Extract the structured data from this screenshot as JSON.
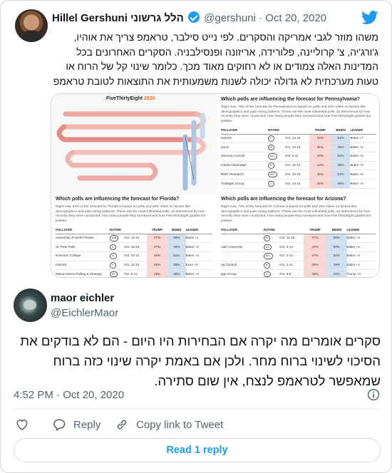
{
  "quoted_tweet": {
    "author_name": "Hillel Gershuni הלל גרשוני",
    "handle": "@gershuni",
    "separator": "·",
    "date": "Oct 20, 2020",
    "text_lines": [
      "משהו מוזר לגבי אמריקה והסקרים. לפי נייט סילבר, טראמפ צריך את אוהיו,",
      "ג'ורג'יה, צ' קרוליינה, פלורידה, אריזונה ופנסילבניה. הסקרים האחרונים בכל",
      "המדינות האלה צמודים או לא רחוקים מאוד מכך. כלומר שינוי קל של הרוח או",
      "טעות מערכתית לא גדולה יכולה לשנות משמעותית את התוצאות לטובת טראמפ"
    ],
    "image": {
      "brand": "FiveThirtyEight",
      "brand_year": "2020",
      "panels": [
        {
          "title": "Which polls are influencing the forecast for Pennsylvania?",
          "description": "Right now, 78% of the forecast for Pennsylvania is based on polls and 22% relies on factors like demographics and past voting patterns. These are the most influential polls, as determined by how recently they were conducted, how many people they surveyed and how FiveThirtyEight grades the pollster.",
          "headers": [
            "POLLSTER",
            "RATING",
            "",
            "TRUMP",
            "BIDEN",
            "LEADER"
          ],
          "rows": [
            {
              "pollster": "HarrisX",
              "rating": "C",
              "date": "Oct. 12-16",
              "trump": "44%",
              "biden": "51%",
              "leader": "Biden +7",
              "lead_party": "b"
            },
            {
              "pollster": "Ipsos",
              "rating": "B",
              "date": "Oct. 13-19",
              "trump": "45%",
              "biden": "49%",
              "leader": "Biden +4",
              "lead_party": "b"
            },
            {
              "pollster": "Morning Consult",
              "rating": "B/C",
              "date": "Oct. 2-11",
              "trump": "44%",
              "biden": "52%",
              "leader": "Biden +8",
              "lead_party": "b"
            },
            {
              "pollster": "InsiderAdvantage",
              "rating": "B",
              "date": "Oct. 12-13",
              "trump": "43%",
              "biden": "46%",
              "leader": "Biden +3",
              "lead_party": "b"
            },
            {
              "pollster": "RMG Research",
              "rating": "B/C",
              "date": "Oct. 13-15",
              "trump": "45%",
              "biden": "51%",
              "leader": "Biden +6",
              "lead_party": "b"
            },
            {
              "pollster": "Trafalgar Group",
              "rating": "C",
              "date": "Oct. 14-16",
              "trump": "45%",
              "biden": "48%",
              "leader": "Biden +3",
              "lead_party": "b"
            }
          ]
        },
        {
          "title": "Which polls are influencing the forecast for Florida?",
          "description": "Right now, 84% of the forecast for Florida is based on polls and 16% relies on factors like demographics and past voting patterns. These are the most influential polls, as determined by how recently they were conducted, how many people they surveyed and how FiveThirtyEight grades the pollster.",
          "headers": [
            "POLLSTER",
            "RATING",
            "",
            "TRUMP",
            "BIDEN",
            "LEADER"
          ],
          "rows": [
            {
              "pollster": "University of North Florida",
              "rating": "A/B",
              "date": "Oct. 12-16",
              "trump": "47%",
              "biden": "48%",
              "leader": "Biden +1",
              "lead_party": "b"
            },
            {
              "pollster": "St. Pete Polls",
              "rating": "C",
              "date": "Oct. 15-19",
              "trump": "47%",
              "biden": "49%",
              "leader": "Biden +2",
              "lead_party": "b"
            },
            {
              "pollster": "Emerson College",
              "rating": "A-",
              "date": "Oct. 10-12",
              "trump": "48%",
              "biden": "51%",
              "leader": "Biden +3",
              "lead_party": "b"
            },
            {
              "pollster": "HarrisX",
              "rating": "C",
              "date": "Oct. 12-15",
              "trump": "48%",
              "biden": "48%",
              "leader": "Even +0",
              "lead_party": "b"
            },
            {
              "pollster": "Mason-Dixon Polling & Strategy",
              "rating": "B+",
              "date": "Oct. 8-12",
              "trump": "45%",
              "biden": "48%",
              "leader": "Biden +3",
              "lead_party": "b"
            },
            {
              "pollster": "Trafalgar Group",
              "rating": "C-",
              "date": "Oct. 11-13",
              "trump": "48%",
              "biden": "46%",
              "leader": "Trump +2",
              "lead_party": "r"
            }
          ]
        },
        {
          "title": "Which polls are influencing the forecast for Arizona?",
          "description": "Right now, 74% of the forecast for Arizona is based on polls and 26% relies on factors like demographics and past voting patterns. These are the most influential polls, as determined by how recently they were conducted, how many people they surveyed and how FiveThirtyEight grades the pollster.",
          "headers": [
            "POLLSTER",
            "RATING",
            "",
            "TRUMP",
            "BIDEN",
            "LEADER"
          ],
          "rows": [
            {
              "pollster": "",
              "rating": "B",
              "date": "Oct. 10-16",
              "trump": "47%",
              "biden": "50%",
              "leader": "Biden +3",
              "lead_party": "b"
            },
            {
              "pollster": "outh University",
              "rating": "A+",
              "date": "Oct. 9-13",
              "trump": "44%",
              "biden": "50%",
              "leader": "Biden +5",
              "lead_party": "b"
            },
            {
              "pollster": "",
              "rating": "B/C",
              "date": "Oct. 2-14",
              "trump": "47%",
              "biden": "50%",
              "leader": "Biden +3",
              "lead_party": "b"
            },
            {
              "pollster": "ng Consult",
              "rating": "B",
              "date": "Oct. 2-11",
              "trump": "45%",
              "biden": "49%",
              "leader": "Biden +4",
              "lead_party": "b"
            },
            {
              "pollster": "lgar Group",
              "rating": "C-",
              "date": "Oct. 6-8",
              "trump": "48%",
              "biden": "44%",
              "leader": "Trump +4",
              "lead_party": "r"
            }
          ]
        }
      ]
    }
  },
  "tweet": {
    "author_name": "maor eichler",
    "handle": "@EichlerMaor",
    "text_lines": [
      "סקרים אומרים מה יקרה אם הבחירות היו היום - הם לא בודקים את",
      "הסיכוי לשינוי ברוח מחר. ולכן אם באמת יקרה שינוי כזה ברוח",
      "שמאפשר לטראמפ לנצח, אין שום סתירה."
    ],
    "timestamp": "4:52 PM · Oct 20, 2020"
  },
  "actions": {
    "like_label": "",
    "reply_label": "Reply",
    "copy_link_label": "Copy link to Tweet"
  },
  "read_replies_label": "Read 1 reply",
  "colors": {
    "twitter_blue": "#1d9bf0",
    "muted_text": "#536471",
    "fte_orange": "#ed713a",
    "trump_red": "#d7302a",
    "biden_blue": "#2a6ab3"
  }
}
